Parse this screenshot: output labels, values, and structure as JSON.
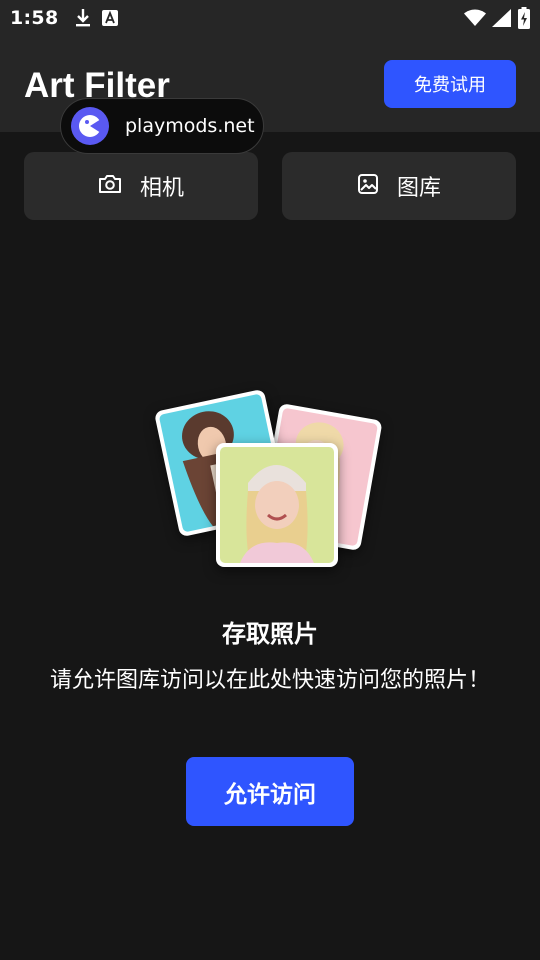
{
  "status_bar": {
    "time": "1:58",
    "left_icons": [
      "download-icon",
      "font-a-icon"
    ],
    "right_icons": [
      "wifi-icon",
      "signal-icon",
      "battery-charging-icon"
    ]
  },
  "header": {
    "title": "Art Filter",
    "trial_label": "免费试用",
    "accent_color": "#2f55ff"
  },
  "watermark": {
    "text": "playmods.net"
  },
  "sources": [
    {
      "icon": "camera-icon",
      "label": "相机"
    },
    {
      "icon": "image-icon",
      "label": "图库"
    }
  ],
  "permission": {
    "title": "存取照片",
    "description": "请允许图库访问以在此处快速访问您的照片！",
    "allow_label": "允许访问"
  }
}
